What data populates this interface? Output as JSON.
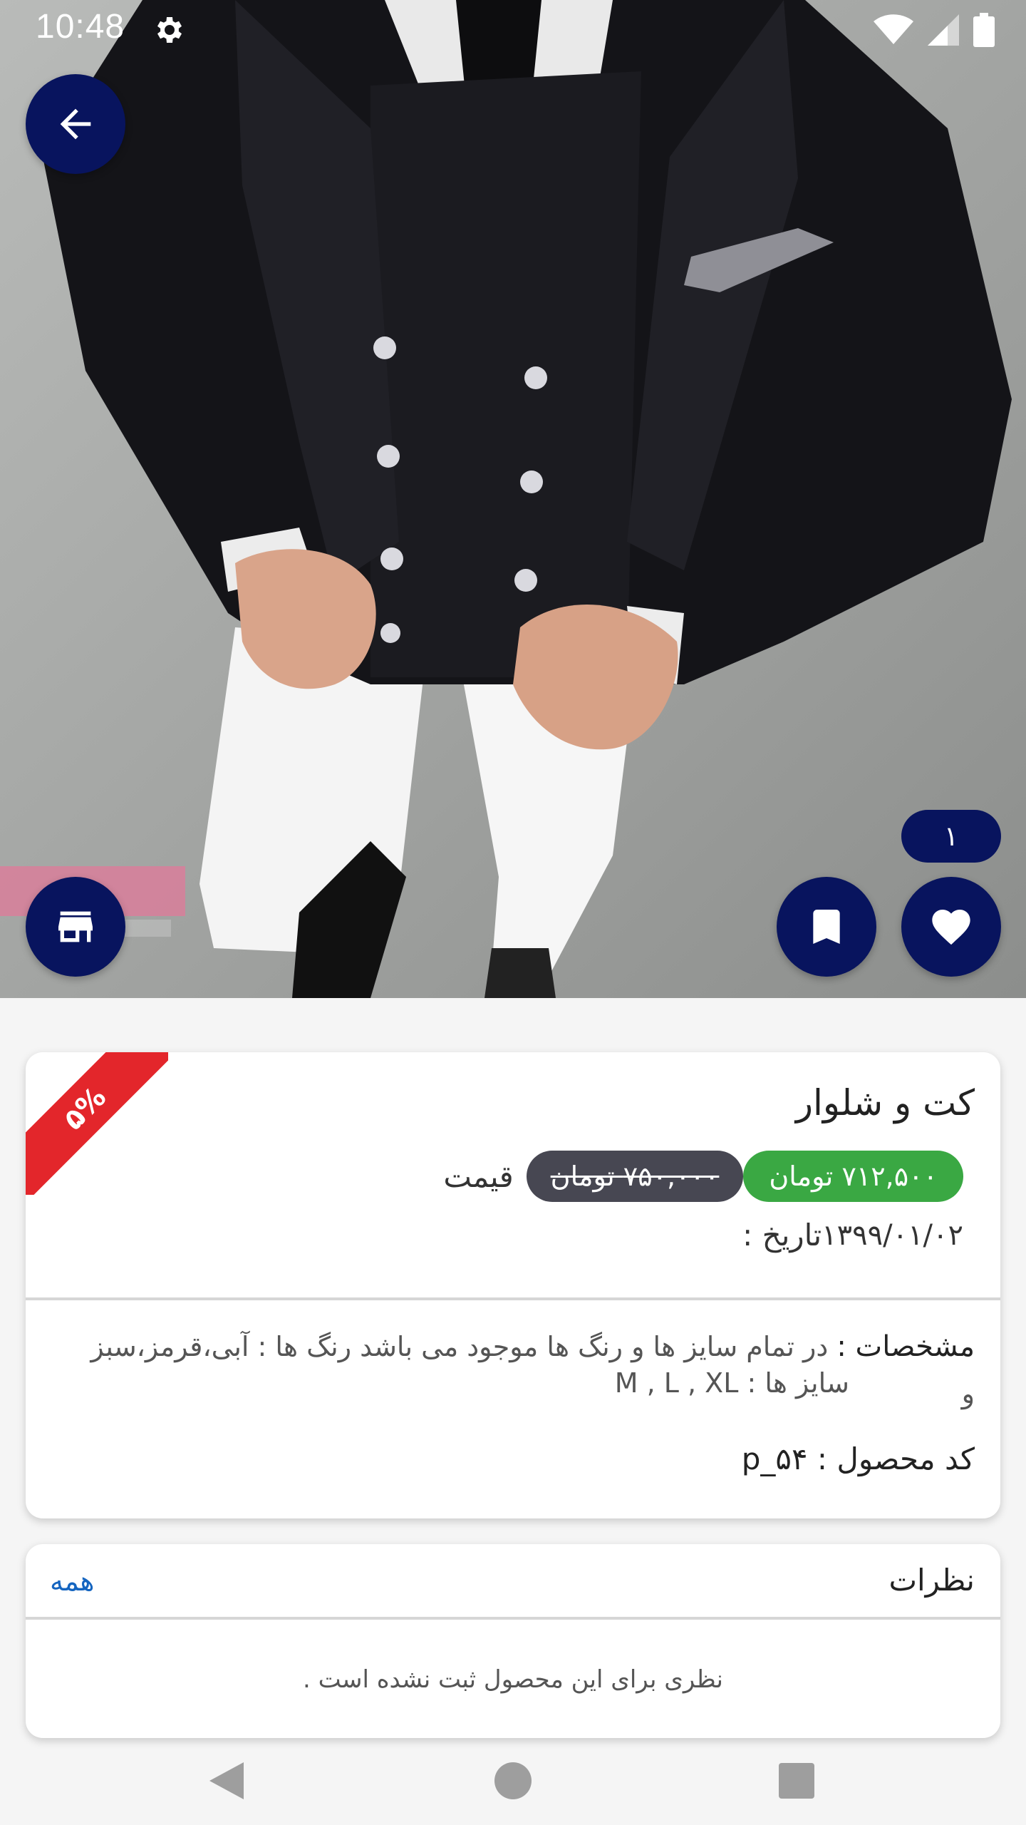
{
  "status_bar": {
    "time": "10:48",
    "icons": [
      "gear-icon",
      "wifi-icon",
      "cell-signal-icon",
      "battery-icon"
    ]
  },
  "hero": {
    "actions": {
      "back": "arrow-back-icon",
      "store": "store-icon",
      "bookmark": "bookmark-icon",
      "like": "heart-icon"
    },
    "like_count": "۱"
  },
  "product": {
    "discount_badge": "۵%",
    "title": "کت و شلوار",
    "price_label": "قیمت",
    "old_price": "۷۵۰,۰۰۰ تومان",
    "new_price": "۷۱۲,۵۰۰ تومان",
    "date_label": "تاریخ :",
    "date_value": "۱۳۹۹/۰۱/۰۲",
    "specs_label": "مشخصات :",
    "specs_text": "در تمام سایز ها و رنگ ها موجود می باشد رنگ ها : آبی،قرمز،سبز و",
    "specs_line2": "سایز ها : M , L ,  XL",
    "code_label": "کد محصول :",
    "code_value": "p_۵۴"
  },
  "comments": {
    "title": "نظرات",
    "all_link": "همه",
    "empty_message": "نظری برای این محصول ثبت نشده است ."
  },
  "nav": {
    "back": "nav-back-icon",
    "home": "nav-home-icon",
    "recents": "nav-recents-icon"
  },
  "colors": {
    "primary_dark_blue": "#08145e",
    "discount_red": "#e3262b",
    "new_price_green": "#3aa843",
    "old_price_gray": "#474752",
    "link_blue": "#1565c0"
  }
}
